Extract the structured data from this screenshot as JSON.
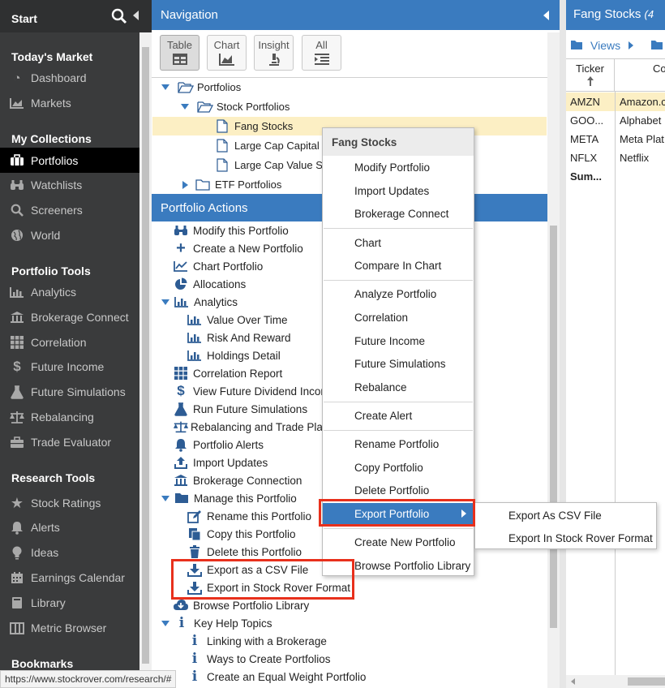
{
  "sidebar": {
    "title": "Start",
    "sections": [
      {
        "label": "Today's Market"
      },
      {
        "label": "My Collections"
      },
      {
        "label": "Portfolio Tools"
      },
      {
        "label": "Research Tools"
      },
      {
        "label": "Bookmarks"
      }
    ],
    "items": [
      {
        "label": "Dashboard",
        "icon": "dashboard-icon"
      },
      {
        "label": "Markets",
        "icon": "chart-icon"
      },
      {
        "label": "Portfolios",
        "icon": "briefcase-icon",
        "active": true
      },
      {
        "label": "Watchlists",
        "icon": "binoculars-icon"
      },
      {
        "label": "Screeners",
        "icon": "search-icon"
      },
      {
        "label": "World",
        "icon": "globe-icon"
      },
      {
        "label": "Analytics",
        "icon": "bar-chart-icon"
      },
      {
        "label": "Brokerage Connect",
        "icon": "bank-icon"
      },
      {
        "label": "Correlation",
        "icon": "grid-icon"
      },
      {
        "label": "Future Income",
        "icon": "dollar-icon"
      },
      {
        "label": "Future Simulations",
        "icon": "flask-icon"
      },
      {
        "label": "Rebalancing",
        "icon": "scale-icon"
      },
      {
        "label": "Trade Evaluator",
        "icon": "toolbox-icon"
      },
      {
        "label": "Stock Ratings",
        "icon": "star-icon"
      },
      {
        "label": "Alerts",
        "icon": "bell-icon"
      },
      {
        "label": "Ideas",
        "icon": "lightbulb-icon"
      },
      {
        "label": "Earnings Calendar",
        "icon": "calendar-icon"
      },
      {
        "label": "Library",
        "icon": "book-icon"
      },
      {
        "label": "Metric Browser",
        "icon": "columns-icon"
      }
    ]
  },
  "status_url": "https://www.stockrover.com/research/#",
  "navigation": {
    "title": "Navigation",
    "toolbar": [
      "Table",
      "Chart",
      "Insight",
      "All"
    ],
    "tree": [
      {
        "label": "Portfolios"
      },
      {
        "label": "Stock Portfolios"
      },
      {
        "label": "Fang Stocks"
      },
      {
        "label": "Large Cap Capital"
      },
      {
        "label": "Large Cap Value S"
      },
      {
        "label": "ETF Portfolios"
      }
    ]
  },
  "portfolio_actions": {
    "title": "Portfolio Actions",
    "items": [
      {
        "label": "Modify this Portfolio"
      },
      {
        "label": "Create a New Portfolio"
      },
      {
        "label": "Chart Portfolio"
      },
      {
        "label": "Allocations"
      },
      {
        "label": "Analytics"
      },
      {
        "label": "Value Over Time"
      },
      {
        "label": "Risk And Reward"
      },
      {
        "label": "Holdings Detail"
      },
      {
        "label": "Correlation Report"
      },
      {
        "label": "View Future Dividend Incor"
      },
      {
        "label": "Run Future Simulations"
      },
      {
        "label": "Rebalancing and Trade Pla"
      },
      {
        "label": "Portfolio Alerts"
      },
      {
        "label": "Import Updates"
      },
      {
        "label": "Brokerage Connection"
      },
      {
        "label": "Manage this Portfolio"
      },
      {
        "label": "Rename this Portfolio"
      },
      {
        "label": "Copy this Portfolio"
      },
      {
        "label": "Delete this Portfolio"
      },
      {
        "label": "Export as a CSV File"
      },
      {
        "label": "Export in Stock Rover Format"
      },
      {
        "label": "Browse Portfolio Library"
      },
      {
        "label": "Key Help Topics"
      },
      {
        "label": "Linking with a Brokerage"
      },
      {
        "label": "Ways to Create Portfolios"
      },
      {
        "label": "Create an Equal Weight Portfolio"
      }
    ]
  },
  "context_menu": {
    "title": "Fang Stocks",
    "items": [
      {
        "label": "Modify Portfolio"
      },
      {
        "label": "Import Updates"
      },
      {
        "label": "Brokerage Connect"
      },
      {
        "label": "Chart"
      },
      {
        "label": "Compare In Chart"
      },
      {
        "label": "Analyze Portfolio"
      },
      {
        "label": "Correlation"
      },
      {
        "label": "Future Income"
      },
      {
        "label": "Future Simulations"
      },
      {
        "label": "Rebalance"
      },
      {
        "label": "Create Alert"
      },
      {
        "label": "Rename Portfolio"
      },
      {
        "label": "Copy Portfolio"
      },
      {
        "label": "Delete Portfolio"
      },
      {
        "label": "Export Portfolio"
      },
      {
        "label": "Create New Portfolio"
      },
      {
        "label": "Browse Portfolio Library"
      }
    ],
    "submenu": [
      {
        "label": "Export As CSV File"
      },
      {
        "label": "Export In Stock Rover Format"
      }
    ]
  },
  "right_panel": {
    "title": "Fang Stocks",
    "title_suffix": "(4",
    "views_label": "Views",
    "col_ticker": "Ticker",
    "col_company": "Co",
    "rows": [
      {
        "ticker": "AMZN",
        "company": "Amazon.c"
      },
      {
        "ticker": "GOO...",
        "company": "Alphabet"
      },
      {
        "ticker": "META",
        "company": "Meta Plat"
      },
      {
        "ticker": "NFLX",
        "company": "Netflix"
      }
    ],
    "summary_label": "Sum..."
  },
  "colors": {
    "accent_blue": "#3a7bbf",
    "highlight_yellow": "#fcefc4",
    "callout_red": "#e8301c"
  }
}
